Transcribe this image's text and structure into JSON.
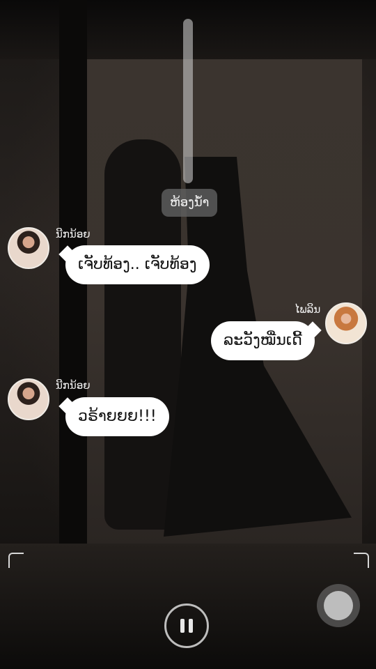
{
  "video": {
    "location_label": "ຫ້ອງນ້ຳ"
  },
  "messages": [
    {
      "side": "left",
      "sender": "ນີກນ້ອຍ",
      "text": "ເຈັບທ້ອງ.. ເຈັບທ້ອງ"
    },
    {
      "side": "right",
      "sender": "ໄພລິນ",
      "text": "ລະວັງໝື່ນເດີ້"
    },
    {
      "side": "left",
      "sender": "ນີກນ້ອຍ",
      "text": "ວຣ້າຍຍຍ!!!"
    }
  ],
  "controls": {
    "pause_icon": "pause-icon",
    "record_icon": "record-icon"
  }
}
